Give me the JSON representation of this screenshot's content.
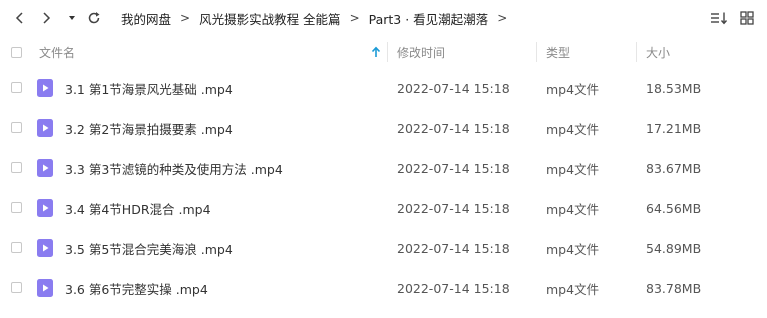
{
  "toolbar": {
    "breadcrumbs": [
      "我的网盘",
      "风光摄影实战教程 全能篇",
      "Part3 · 看见潮起潮落"
    ]
  },
  "header": {
    "name": "文件名",
    "modified": "修改时间",
    "type": "类型",
    "size": "大小",
    "sort_column": "文件名",
    "sort_direction": "ascending"
  },
  "colors": {
    "accent": "#1a9ad6",
    "file_icon": "#8a7cf0"
  },
  "files": [
    {
      "name": "3.1 第1节海景风光基础 .mp4",
      "modified": "2022-07-14 15:18",
      "type": "mp4文件",
      "size": "18.53MB"
    },
    {
      "name": "3.2 第2节海景拍摄要素 .mp4",
      "modified": "2022-07-14 15:18",
      "type": "mp4文件",
      "size": "17.21MB"
    },
    {
      "name": "3.3 第3节滤镜的种类及使用方法 .mp4",
      "modified": "2022-07-14 15:18",
      "type": "mp4文件",
      "size": "83.67MB"
    },
    {
      "name": "3.4 第4节HDR混合 .mp4",
      "modified": "2022-07-14 15:18",
      "type": "mp4文件",
      "size": "64.56MB"
    },
    {
      "name": "3.5 第5节混合完美海浪 .mp4",
      "modified": "2022-07-14 15:18",
      "type": "mp4文件",
      "size": "54.89MB"
    },
    {
      "name": "3.6 第6节完整实操 .mp4",
      "modified": "2022-07-14 15:18",
      "type": "mp4文件",
      "size": "83.78MB"
    }
  ]
}
